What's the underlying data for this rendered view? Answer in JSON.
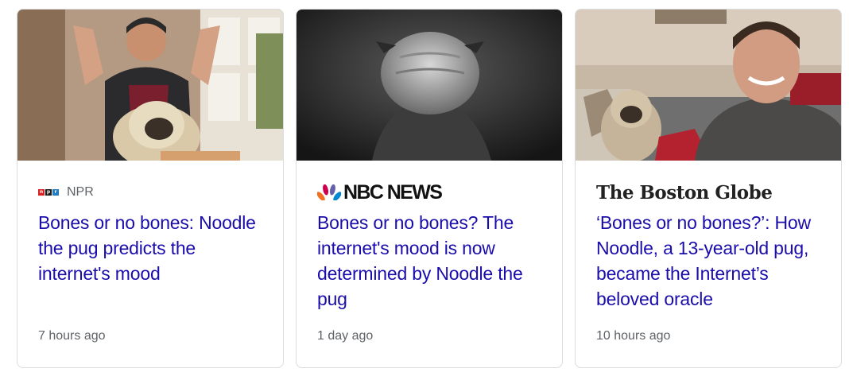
{
  "cards": [
    {
      "source": "NPR",
      "title": "Bones or no bones: Noodle the pug predicts the internet's mood",
      "time": "7 hours ago"
    },
    {
      "source": "NBC NEWS",
      "title": "Bones or no bones? The internet's mood is now determined by Noodle the pug",
      "time": "1 day ago"
    },
    {
      "source": "The Boston Globe",
      "title": "‘Bones or no bones?’: How Noodle, a 13-year-old pug, became the Internet’s beloved oracle",
      "time": "10 hours ago"
    }
  ],
  "colors": {
    "title_link": "#1a0dab",
    "meta_text": "#5f6368",
    "card_border": "#dadce0"
  }
}
